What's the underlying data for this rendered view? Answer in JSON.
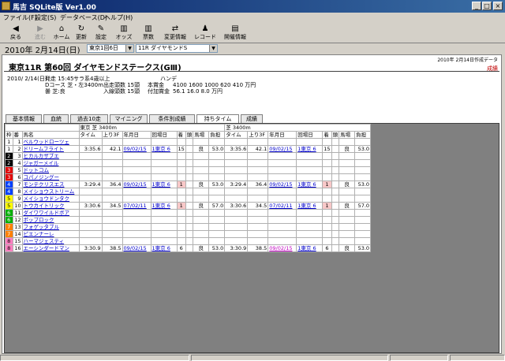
{
  "window": {
    "title": "馬吉 SQLite版  Ver1.00"
  },
  "menu": [
    "ファイル(F)",
    "設定(S)",
    "データベース(D)",
    "ヘルプ(H)"
  ],
  "toolbar": [
    {
      "icon": "◀",
      "label": "戻る",
      "enabled": true
    },
    {
      "icon": "▶",
      "label": "進む",
      "enabled": false
    },
    {
      "icon": "⌂",
      "label": "ホーム",
      "enabled": true
    },
    {
      "icon": "↻",
      "label": "更新",
      "enabled": true
    },
    {
      "icon": "✎",
      "label": "設定",
      "enabled": true
    },
    {
      "icon": "▥",
      "label": "オッズ",
      "enabled": true
    },
    {
      "icon": "▥",
      "label": "票数",
      "enabled": true
    },
    {
      "icon": "⇄",
      "label": "変更情報",
      "enabled": true
    },
    {
      "icon": "♟",
      "label": "レコード",
      "enabled": true
    },
    {
      "icon": "▤",
      "label": "開催情報",
      "enabled": true
    }
  ],
  "datebar": {
    "date": "2010年 2月14日(日)",
    "meeting": "東京1回6日",
    "race": "11R ダイヤモンドS"
  },
  "race": {
    "created": "2010年 2月14日作成データ",
    "title": "東京11R 第60回 ダイヤモンドステークス(GⅢ)",
    "tag": "成績",
    "date": "2010/ 2/14(日)",
    "start": "発走 15:45",
    "cls": "サラ系4歳以上",
    "handicap": "ハンデ",
    "course": "Dコース 芝・左3400m",
    "runners": "出走頭数 15頭",
    "prize_label": "本賞金",
    "prize": "4100  1600  1000  620  410 万円",
    "weather": "曇 芝:良",
    "entries": "入線頭数 15頭",
    "added_label": "付加賞金",
    "added": "56.1  16.0  8.0 万円"
  },
  "tabs": [
    "基本情報",
    "血統",
    "過去10走",
    "マイニング",
    "条件別成績",
    "持ちタイム",
    "成績"
  ],
  "active_tab": 5,
  "table": {
    "group1": "東京 芝 3400m",
    "group2": "芝 3400m",
    "headers": [
      "枠",
      "番",
      "馬名",
      "タイム",
      "上り3F",
      "年月日",
      "回場日",
      "着",
      "頭",
      "馬場",
      "負担",
      "タイム",
      "上り3F",
      "年月日",
      "回場日",
      "着",
      "頭",
      "馬場",
      "負担"
    ],
    "rows": [
      {
        "waku": "1",
        "ban": "1",
        "name": "ベルウッドローツェ",
        "data": null
      },
      {
        "waku": "1",
        "ban": "2",
        "name": "ドリームフライト",
        "data": {
          "time": "3:35.6",
          "f3": "42.1",
          "date": "09/02/15",
          "kai": "1東京 6",
          "chaku": "15",
          "tou": "",
          "baba": "良",
          "futan": "53.0",
          "time2": "3:35.6",
          "f32": "42.1",
          "date2": "09/02/15",
          "kai2": "1東京 6",
          "chaku2": "15",
          "tou2": "",
          "baba2": "良",
          "futan2": "53.0",
          "pink": false,
          "visited": false
        }
      },
      {
        "waku": "2",
        "ban": "3",
        "name": "ヒカルカザブエ",
        "data": null
      },
      {
        "waku": "2",
        "ban": "4",
        "name": "ジャガーメイル",
        "data": null
      },
      {
        "waku": "3",
        "ban": "5",
        "name": "ドットコム",
        "data": null
      },
      {
        "waku": "3",
        "ban": "6",
        "name": "コパノジングー",
        "data": null
      },
      {
        "waku": "4",
        "ban": "7",
        "name": "モンテクリスエス",
        "data": {
          "time": "3:29.4",
          "f3": "36.4",
          "date": "09/02/15",
          "kai": "1東京 6",
          "chaku": "1",
          "tou": "",
          "baba": "良",
          "futan": "53.0",
          "time2": "3:29.4",
          "f32": "36.4",
          "date2": "09/02/15",
          "kai2": "1東京 6",
          "chaku2": "1",
          "tou2": "",
          "baba2": "良",
          "futan2": "53.0",
          "pink": true,
          "visited": false
        }
      },
      {
        "waku": "4",
        "ban": "8",
        "name": "メイショウストリーム",
        "data": null
      },
      {
        "waku": "5",
        "ban": "9",
        "name": "メイショウドンタク",
        "data": null
      },
      {
        "waku": "5",
        "ban": "10",
        "name": "トウカイトリック",
        "data": {
          "time": "3:30.6",
          "f3": "34.5",
          "date": "07/02/11",
          "kai": "1東京 6",
          "chaku": "1",
          "tou": "",
          "baba": "良",
          "futan": "57.0",
          "time2": "3:30.6",
          "f32": "34.5",
          "date2": "07/02/11",
          "kai2": "1東京 6",
          "chaku2": "1",
          "tou2": "",
          "baba2": "良",
          "futan2": "57.0",
          "pink": true,
          "visited": false
        }
      },
      {
        "waku": "6",
        "ban": "11",
        "name": "ダイワワイルドボア",
        "data": null
      },
      {
        "waku": "6",
        "ban": "12",
        "name": "ポップロック",
        "data": null
      },
      {
        "waku": "7",
        "ban": "13",
        "name": "フォゲッタブル",
        "data": null
      },
      {
        "waku": "7",
        "ban": "14",
        "name": "ピエンナーレ",
        "data": null
      },
      {
        "waku": "8",
        "ban": "15",
        "name": "ハーマジェスティ",
        "data": null
      },
      {
        "waku": "8",
        "ban": "16",
        "name": "エーシンダードマン",
        "data": {
          "time": "3:30.9",
          "f3": "38.5",
          "date": "09/02/15",
          "kai": "1東京 6",
          "chaku": "6",
          "tou": "",
          "baba": "良",
          "futan": "53.0",
          "time2": "3:30.9",
          "f32": "38.5",
          "date2": "09/02/15",
          "kai2": "1東京 6",
          "chaku2": "6",
          "tou2": "",
          "baba2": "良",
          "futan2": "53.0",
          "pink": false,
          "visited": true
        }
      }
    ]
  },
  "colors": {
    "waku": {
      "1": "#ffffff",
      "2": "#000000",
      "3": "#e00000",
      "4": "#0040ff",
      "5": "#ffff00",
      "6": "#00b000",
      "7": "#ff8000",
      "8": "#ff80c0"
    },
    "waku_text": {
      "1": "#000000",
      "2": "#ffffff",
      "3": "#ffffff",
      "4": "#ffffff",
      "5": "#000000",
      "6": "#ffffff",
      "7": "#ffffff",
      "8": "#000000"
    }
  }
}
